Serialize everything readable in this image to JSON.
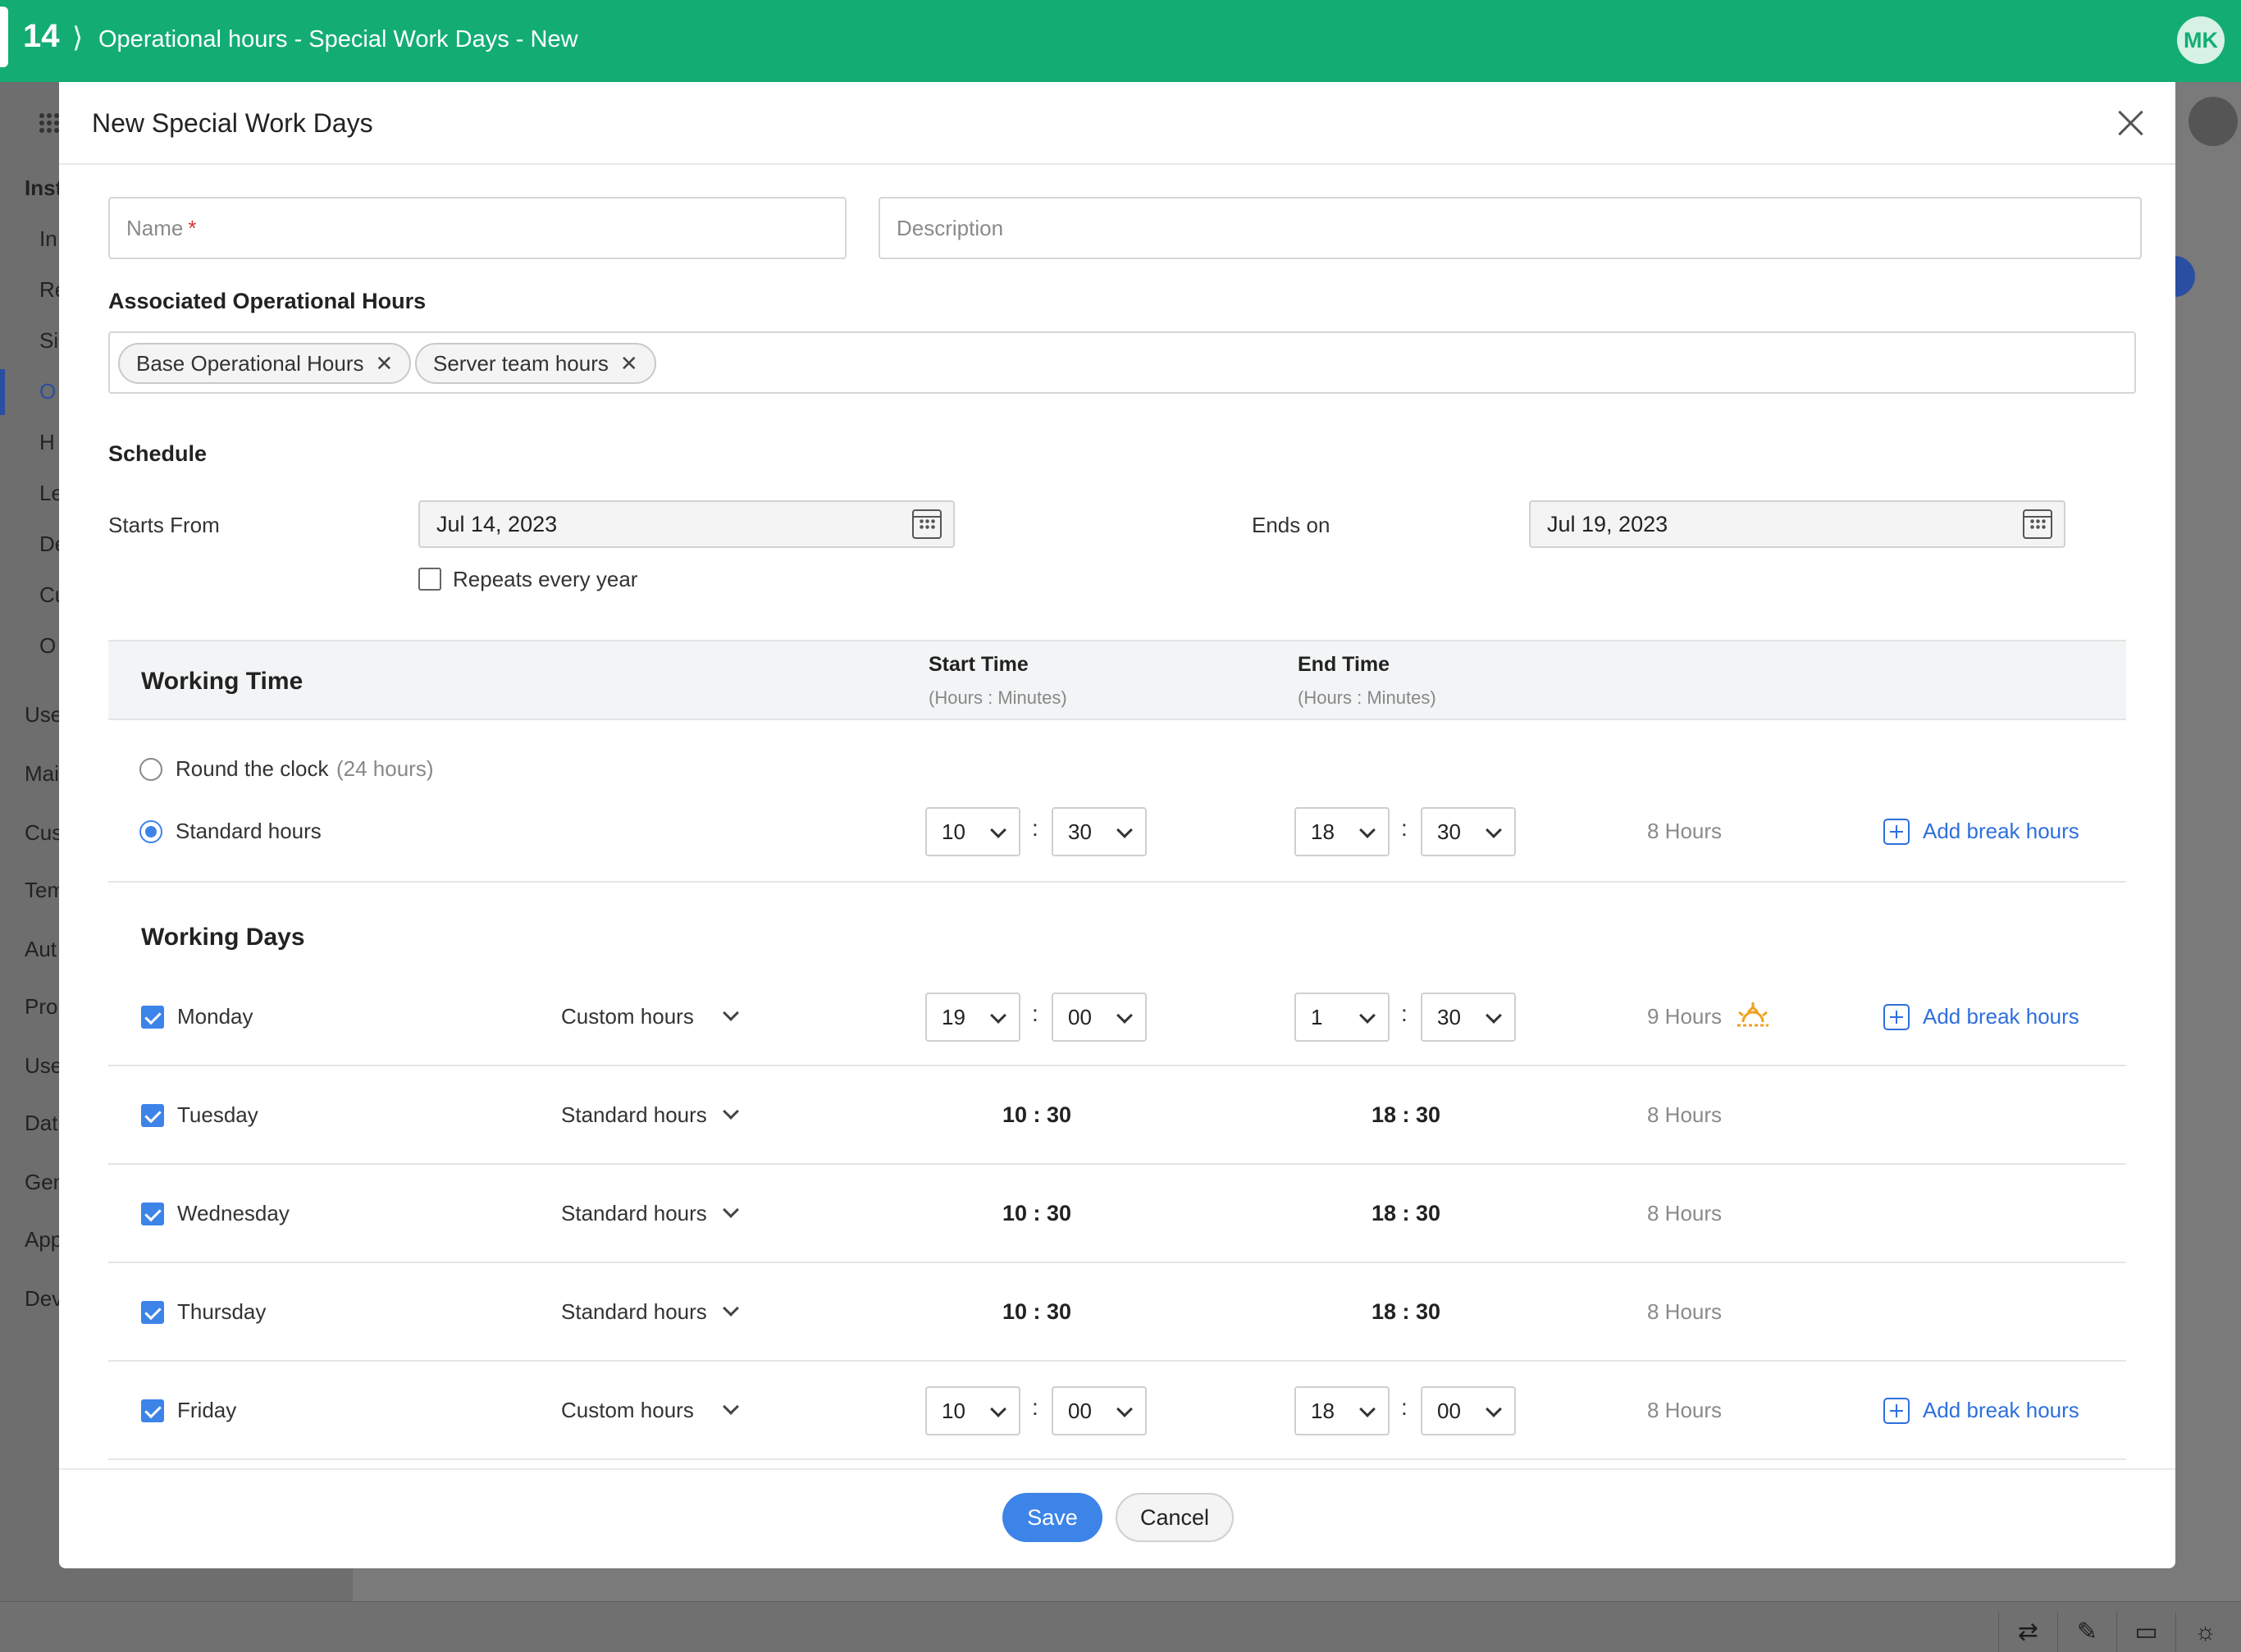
{
  "topbar": {
    "app_number": "14",
    "breadcrumb_sep": "⟩",
    "title": "Operational hours - Special Work Days - New",
    "avatar_initials": "MK",
    "brand_color": "#13ad74"
  },
  "background": {
    "sidebar_items": [
      "Inst",
      "In",
      "Re",
      "Si",
      "O",
      "H",
      "Le",
      "De",
      "Cu",
      "O",
      "Use",
      "Mai",
      "Cus",
      "Tem",
      "Aut",
      "Pro",
      "Use",
      "Dat",
      "Gen",
      "App",
      "Dev"
    ],
    "bottom_icons": [
      "translate-icon",
      "notes-icon",
      "chat-icon",
      "bulb-icon"
    ]
  },
  "modal": {
    "title": "New Special Work Days",
    "name_placeholder": "Name",
    "name_required_mark": "*",
    "description_placeholder": "Description",
    "associated_label": "Associated Operational Hours",
    "associated_tags": [
      "Base Operational Hours",
      "Server team hours"
    ],
    "tag_remove": "✕",
    "schedule_label": "Schedule",
    "starts_from_label": "Starts From",
    "starts_from_value": "Jul 14, 2023",
    "ends_on_label": "Ends on",
    "ends_on_value": "Jul 19, 2023",
    "repeats_label": "Repeats every year",
    "repeats_checked": false,
    "working_time": {
      "title": "Working Time",
      "start_time_label": "Start Time",
      "start_time_sub": "(Hours : Minutes)",
      "end_time_label": "End Time",
      "end_time_sub": "(Hours : Minutes)",
      "round_clock_label": "Round the clock",
      "round_clock_sub": "(24 hours)",
      "standard_label": "Standard hours",
      "selected": "standard",
      "start_h": "10",
      "start_m": "30",
      "end_h": "18",
      "end_m": "30",
      "hours": "8 Hours",
      "add_break": "Add break hours"
    },
    "working_days": {
      "title": "Working Days",
      "colon": ":",
      "days": [
        {
          "name": "Monday",
          "checked": true,
          "type": "Custom hours",
          "start_h": "19",
          "start_m": "00",
          "end_h": "1",
          "end_m": "30",
          "hours": "9 Hours",
          "overnight_icon": "sunrise-icon",
          "add_break": "Add break hours"
        },
        {
          "name": "Tuesday",
          "checked": true,
          "type": "Standard hours",
          "start": "10 : 30",
          "end": "18 : 30",
          "hours": "8 Hours"
        },
        {
          "name": "Wednesday",
          "checked": true,
          "type": "Standard hours",
          "start": "10 : 30",
          "end": "18 : 30",
          "hours": "8 Hours"
        },
        {
          "name": "Thursday",
          "checked": true,
          "type": "Standard hours",
          "start": "10 : 30",
          "end": "18 : 30",
          "hours": "8 Hours"
        },
        {
          "name": "Friday",
          "checked": true,
          "type": "Custom hours",
          "start_h": "10",
          "start_m": "00",
          "end_h": "18",
          "end_m": "00",
          "hours": "8 Hours",
          "add_break": "Add break hours"
        }
      ]
    },
    "save_label": "Save",
    "cancel_label": "Cancel",
    "accent_color": "#3d84e8"
  }
}
